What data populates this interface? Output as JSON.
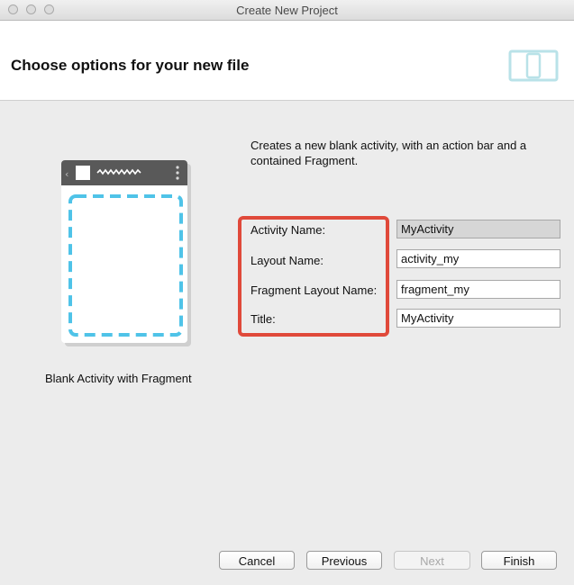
{
  "window": {
    "title": "Create New Project"
  },
  "header": {
    "title": "Choose options for your new file",
    "icon": "device-layout-icon"
  },
  "template": {
    "caption": "Blank Activity with Fragment"
  },
  "description": "Creates a new blank activity, with an action bar and a contained Fragment.",
  "form": {
    "fields": [
      {
        "label": "Activity Name:",
        "value": "MyActivity",
        "selected": true
      },
      {
        "label": "Layout Name:",
        "value": "activity_my"
      },
      {
        "label": "Fragment Layout Name:",
        "value": "fragment_my"
      },
      {
        "label": "Title:",
        "value": "MyActivity"
      }
    ]
  },
  "buttons": {
    "cancel": "Cancel",
    "previous": "Previous",
    "next": "Next",
    "finish": "Finish"
  },
  "colors": {
    "highlight": "#e0493a",
    "accent": "#4fc3e8",
    "header_icon": "#b9e2e8"
  }
}
